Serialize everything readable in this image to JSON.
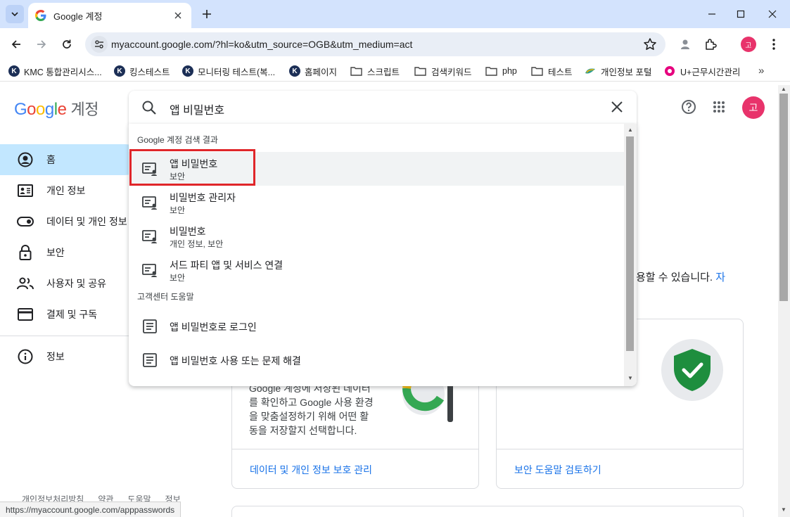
{
  "browser": {
    "tab": {
      "title": "Google 계정"
    },
    "url": "myaccount.google.com/?hl=ko&utm_source=OGB&utm_medium=act",
    "profile_initial": "고",
    "status_url": "https://myaccount.google.com/apppasswords"
  },
  "bookmarks": {
    "items": [
      {
        "label": "KMC 통합관리시스...",
        "icon": "k-circle-icon"
      },
      {
        "label": "킹스테스트",
        "icon": "k-circle-icon"
      },
      {
        "label": "모니터링 테스트(복...",
        "icon": "k-circle-icon"
      },
      {
        "label": "홈페이지",
        "icon": "k-circle-icon"
      },
      {
        "label": "스크립트",
        "icon": "folder-icon"
      },
      {
        "label": "검색키워드",
        "icon": "folder-icon"
      },
      {
        "label": "php",
        "icon": "folder-icon"
      },
      {
        "label": "테스트",
        "icon": "folder-icon"
      },
      {
        "label": "개인정보 포털",
        "icon": "portal-icon"
      },
      {
        "label": "U+근무시간관리",
        "icon": "uplus-icon"
      }
    ],
    "more": "»"
  },
  "header": {
    "logo_letters": [
      "G",
      "o",
      "o",
      "g",
      "l",
      "e"
    ],
    "logo_suffix": "계정",
    "search_query": "앱 비밀번호",
    "avatar_initial": "고"
  },
  "sidebar": {
    "items": [
      {
        "label": "홈",
        "icon": "account-circle-icon",
        "active": true
      },
      {
        "label": "개인 정보",
        "icon": "id-card-icon",
        "active": false
      },
      {
        "label": "데이터 및 개인 정보",
        "icon": "toggle-icon",
        "active": false
      },
      {
        "label": "보안",
        "icon": "lock-icon",
        "active": false
      },
      {
        "label": "사용자 및 공유",
        "icon": "people-icon",
        "active": false
      },
      {
        "label": "결제 및 구독",
        "icon": "credit-card-icon",
        "active": false
      },
      {
        "label": "정보",
        "icon": "info-icon",
        "active": false
      }
    ],
    "footer": [
      "개인정보처리방침",
      "약관",
      "도움말",
      "정보"
    ]
  },
  "main": {
    "intro_text": "용할 수 있습니다.",
    "intro_link": "자",
    "privacy_card": {
      "body": [
        "Google 계정에 저장된 데이터",
        "를 확인하고 Google 사용 환경",
        "을 맞춤설정하기 위해 어떤 활",
        "동을 저장할지 선택합니다."
      ],
      "link": "데이터 및 개인 정보 보호 관리"
    },
    "security_card": {
      "link": "보안 도움말 검토하기"
    }
  },
  "dropdown": {
    "section_account": "Google 계정 검색 결과",
    "account_results": [
      {
        "title": "앱 비밀번호",
        "subtitle": "보안"
      },
      {
        "title": "비밀번호 관리자",
        "subtitle": "보안"
      },
      {
        "title": "비밀번호",
        "subtitle": "개인 정보, 보안"
      },
      {
        "title": "서드 파티 앱 및 서비스 연결",
        "subtitle": "보안"
      }
    ],
    "section_help": "고객센터 도움말",
    "help_results": [
      {
        "title": "앱 비밀번호로 로그인"
      },
      {
        "title": "앱 비밀번호 사용 또는 문제 해결"
      }
    ]
  },
  "colors": {
    "accent_blue": "#1a73e8",
    "active_nav_bg": "#c2e7ff",
    "highlight_red": "#e0262a",
    "avatar_pink": "#e8336b",
    "shield_green": "#1e8e3e"
  }
}
